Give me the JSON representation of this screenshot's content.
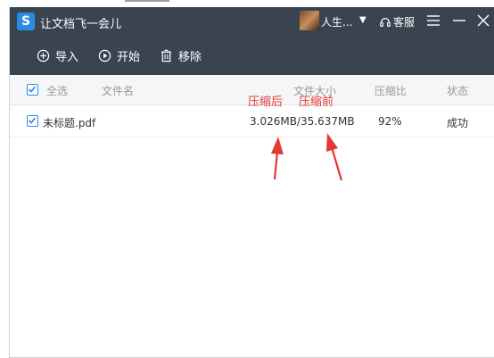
{
  "app": {
    "title": "让文档飞一会儿",
    "logo_letter": "S",
    "user_name": "人生...",
    "support_label": "客服"
  },
  "toolbar": {
    "import_label": "导入",
    "start_label": "开始",
    "remove_label": "移除"
  },
  "table": {
    "headers": {
      "select_all": "全选",
      "file_name": "文件名",
      "file_size": "文件大小",
      "ratio": "压缩比",
      "status": "状态"
    },
    "rows": [
      {
        "checked": true,
        "name": "未标题.pdf",
        "size": "3.026MB/35.637MB",
        "ratio": "92%",
        "status": "成功"
      }
    ]
  },
  "annotations": {
    "after": "压缩后",
    "before": "压缩前",
    "color": "#e53935"
  },
  "colors": {
    "titlebar": "#3a4350",
    "accent": "#2a8be4"
  },
  "icons": [
    "app-logo-icon",
    "avatar",
    "headset-icon",
    "menu-icon",
    "minimize-icon",
    "close-icon",
    "plus-circle-icon",
    "play-circle-icon",
    "trash-icon",
    "checkbox-icon"
  ]
}
